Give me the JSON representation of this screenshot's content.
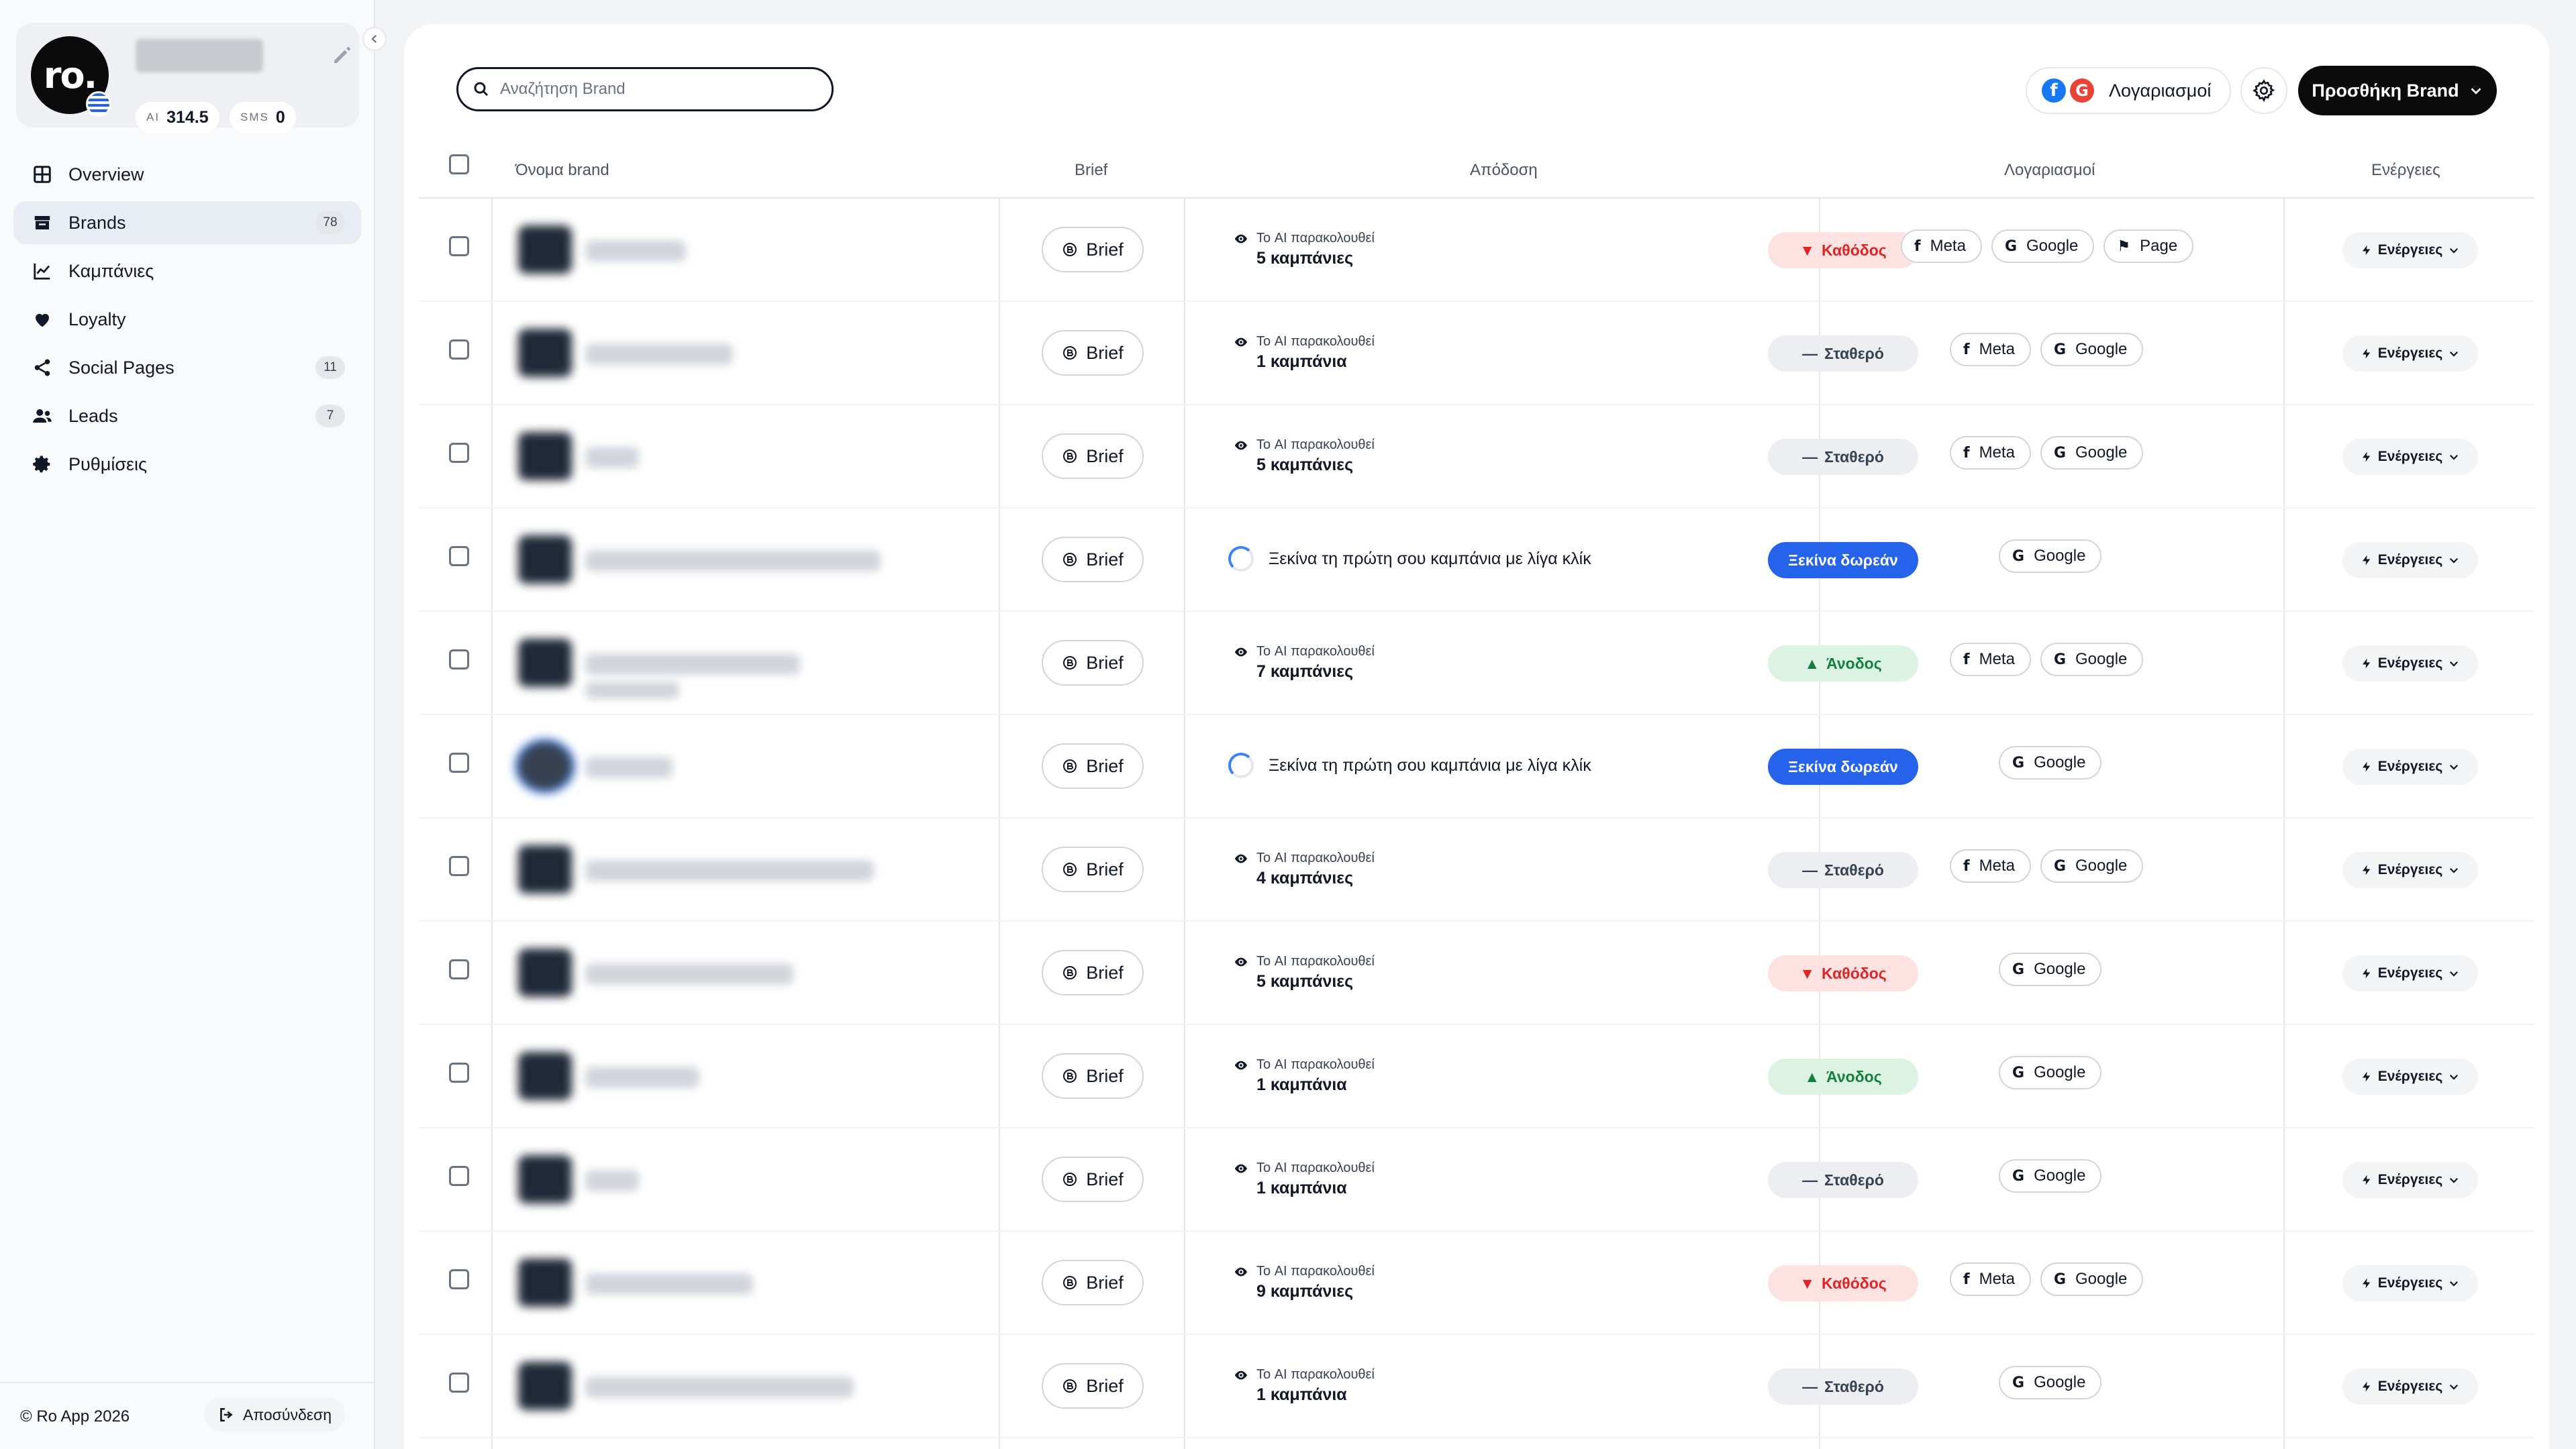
{
  "sidebar": {
    "logo_text": "ro.",
    "ai_label": "AI",
    "ai_value": "314.5",
    "sms_label": "SMS",
    "sms_value": "0",
    "nav": [
      {
        "label": "Overview",
        "icon": "grid-icon",
        "badge": null,
        "active": false
      },
      {
        "label": "Brands",
        "icon": "store-icon",
        "badge": "78",
        "active": true
      },
      {
        "label": "Καμπάνιες",
        "icon": "chart-line-icon",
        "badge": null,
        "active": false
      },
      {
        "label": "Loyalty",
        "icon": "heart-icon",
        "badge": null,
        "active": false
      },
      {
        "label": "Social Pages",
        "icon": "share-icon",
        "badge": "11",
        "active": false
      },
      {
        "label": "Leads",
        "icon": "users-icon",
        "badge": "7",
        "active": false
      },
      {
        "label": "Ρυθμίσεις",
        "icon": "gear-icon",
        "badge": null,
        "active": false
      }
    ],
    "copyright": "© Ro App 2026",
    "logout_label": "Αποσύνδεση"
  },
  "toolbar": {
    "search_placeholder": "Αναζήτηση Brand",
    "accounts_label": "Λογαριασμοί",
    "add_brand_label": "Προσθήκη Brand"
  },
  "table": {
    "headers": {
      "name": "Όνομα brand",
      "brief": "Brief",
      "performance": "Απόδοση",
      "accounts": "Λογαριασμοί",
      "actions": "Ενέργειες"
    },
    "brief_label": "Brief",
    "monitor_label": "Το AI παρακολουθεί",
    "empty_label": "Ξεκίνα τη πρώτη σου καμπάνια με λίγα κλίκ",
    "free_label": "Ξεκίνα δωρεάν",
    "actions_label": "Ενέργειες",
    "rows": [
      {
        "campaigns": "5 καμπάνιες",
        "trend": "down",
        "trend_label": "Καθόδος",
        "accounts": [
          "Meta",
          "Google",
          "Page"
        ]
      },
      {
        "campaigns": "1 καμπάνια",
        "trend": "flat",
        "trend_label": "Σταθερό",
        "accounts": [
          "Meta",
          "Google"
        ]
      },
      {
        "campaigns": "5 καμπάνιες",
        "trend": "flat",
        "trend_label": "Σταθερό",
        "accounts": [
          "Meta",
          "Google"
        ]
      },
      {
        "campaigns": null,
        "trend": "free",
        "trend_label": "Ξεκίνα δωρεάν",
        "accounts": [
          "Google"
        ]
      },
      {
        "campaigns": "7 καμπάνιες",
        "trend": "up",
        "trend_label": "Άνοδος",
        "accounts": [
          "Meta",
          "Google"
        ]
      },
      {
        "campaigns": null,
        "trend": "free",
        "trend_label": "Ξεκίνα δωρεάν",
        "accounts": [
          "Google"
        ]
      },
      {
        "campaigns": "4 καμπάνιες",
        "trend": "flat",
        "trend_label": "Σταθερό",
        "accounts": [
          "Meta",
          "Google"
        ]
      },
      {
        "campaigns": "5 καμπάνιες",
        "trend": "down",
        "trend_label": "Καθόδος",
        "accounts": [
          "Google"
        ]
      },
      {
        "campaigns": "1 καμπάνια",
        "trend": "up",
        "trend_label": "Άνοδος",
        "accounts": [
          "Google"
        ]
      },
      {
        "campaigns": "1 καμπάνια",
        "trend": "flat",
        "trend_label": "Σταθερό",
        "accounts": [
          "Google"
        ]
      },
      {
        "campaigns": "9 καμπάνιες",
        "trend": "down",
        "trend_label": "Καθόδος",
        "accounts": [
          "Meta",
          "Google"
        ]
      },
      {
        "campaigns": "1 καμπάνια",
        "trend": "flat",
        "trend_label": "Σταθερό",
        "accounts": [
          "Google"
        ]
      }
    ]
  },
  "colors": {
    "accent_blue": "#2563eb",
    "down_red": "#dc2626",
    "up_green": "#15803d",
    "black_button": "#0b0b0b"
  }
}
